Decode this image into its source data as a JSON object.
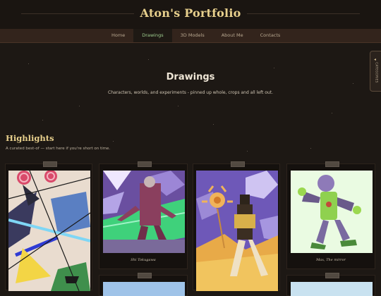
{
  "site": {
    "title": "Aton's Portfolio"
  },
  "nav": {
    "items": [
      {
        "label": "Home",
        "active": false
      },
      {
        "label": "Drawings",
        "active": true
      },
      {
        "label": "3D Models",
        "active": false
      },
      {
        "label": "About Me",
        "active": false
      },
      {
        "label": "Contacts",
        "active": false
      }
    ]
  },
  "side_tab": {
    "label": "CATEGORIES"
  },
  "section": {
    "title": "Drawings",
    "subtitle": "Characters, worlds, and experiments - pinned up whole, crops and all left out."
  },
  "highlights": {
    "title": "Highlights",
    "subtitle": "A curated best-of — start here if you're short on time."
  },
  "cards": [
    {
      "caption": ""
    },
    {
      "caption": "Shi Tokugawa"
    },
    {
      "caption": ""
    },
    {
      "caption": "Max, The mirror"
    }
  ],
  "colors": {
    "background": "#1d1814",
    "title_gold": "#e7cf8c",
    "nav_bg": "#33241c",
    "nav_active_text": "#9fcf8f"
  }
}
